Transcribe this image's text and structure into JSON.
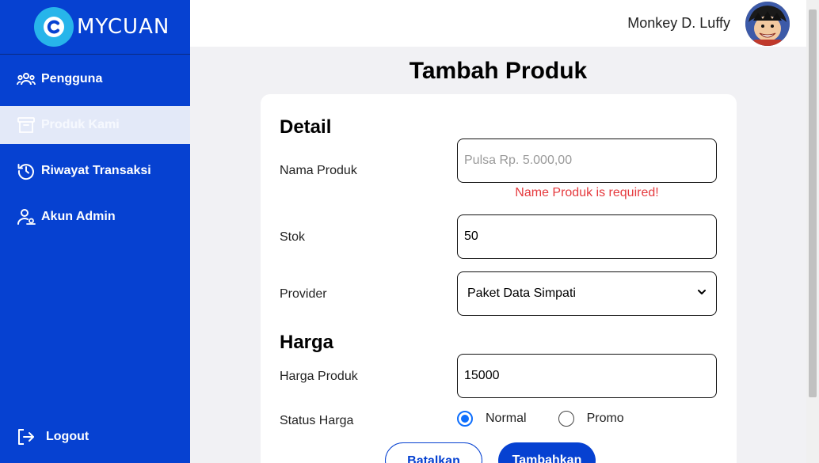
{
  "brand": {
    "name": "MYCUAN"
  },
  "sidebar": {
    "items": [
      {
        "label": "Pengguna",
        "icon": "users-icon"
      },
      {
        "label": "Produk Kami",
        "icon": "archive-box-icon",
        "active": true
      },
      {
        "label": "Riwayat Transaksi",
        "icon": "history-icon"
      },
      {
        "label": "Akun Admin",
        "icon": "user-gear-icon"
      }
    ],
    "logout_label": "Logout"
  },
  "header": {
    "username": "Monkey D. Luffy"
  },
  "page": {
    "title": "Tambah Produk"
  },
  "form": {
    "detail_title": "Detail",
    "nama_label": "Nama Produk",
    "nama_placeholder": "Pulsa Rp. 5.000,00",
    "nama_value": "",
    "nama_error": "Name Produk is required!",
    "stok_label": "Stok",
    "stok_value": "50",
    "provider_label": "Provider",
    "provider_value": "Paket Data Simpati",
    "harga_title": "Harga",
    "harga_label": "Harga Produk",
    "harga_value": "15000",
    "status_label": "Status Harga",
    "status_options": [
      "Normal",
      "Promo"
    ],
    "status_selected": "Normal",
    "cancel_label": "Batalkan",
    "submit_label": "Tambahkan"
  },
  "colors": {
    "primary": "#0641d1",
    "logo": "#27b5ea",
    "error": "#e5393d",
    "radio": "#0d6efd"
  }
}
